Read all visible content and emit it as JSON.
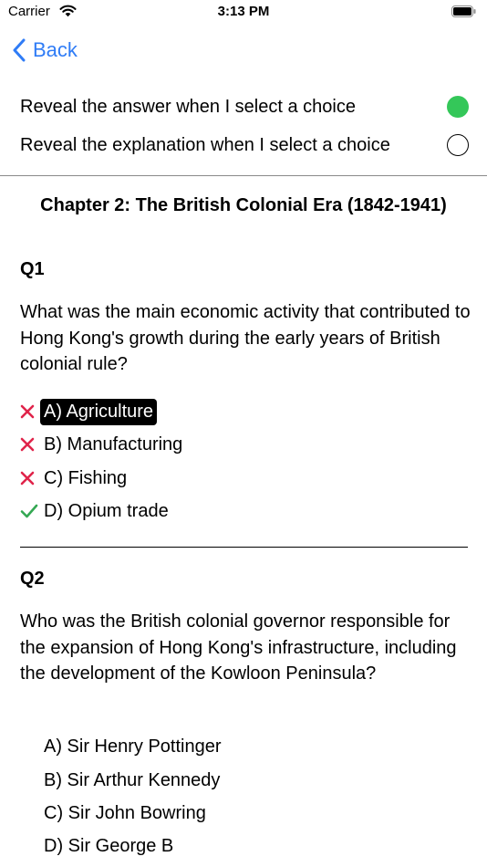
{
  "status_bar": {
    "carrier": "Carrier",
    "time": "3:13 PM"
  },
  "nav": {
    "back_label": "Back",
    "accent_color": "#2f7cf6"
  },
  "settings": {
    "reveal_answer": {
      "label": "Reveal the answer when I select a choice",
      "enabled": true
    },
    "reveal_explanation": {
      "label": "Reveal the explanation when I select a choice",
      "enabled": false
    }
  },
  "chapter": {
    "title": "Chapter 2: The British Colonial Era (1842-1941)"
  },
  "questions": [
    {
      "label": "Q1",
      "text": "What was the main economic activity that contributed to Hong Kong's growth during the early years of British colonial rule?",
      "choices": [
        {
          "text": "A) Agriculture",
          "mark": "x-icon",
          "selected": true
        },
        {
          "text": "B) Manufacturing",
          "mark": "x-icon",
          "selected": false
        },
        {
          "text": "C) Fishing",
          "mark": "x-icon",
          "selected": false
        },
        {
          "text": "D) Opium trade",
          "mark": "checkmark-icon",
          "selected": false
        }
      ]
    },
    {
      "label": "Q2",
      "text": "Who was the British colonial governor responsible for the expansion of Hong Kong's infrastructure, including the development of the Kowloon Peninsula?",
      "choices": [
        {
          "text": "A) Sir Henry Pottinger"
        },
        {
          "text": "B) Sir Arthur Kennedy"
        },
        {
          "text": "C) Sir John Bowring"
        },
        {
          "text": "D) Sir George B"
        }
      ]
    }
  ],
  "colors": {
    "correct": "#34a853",
    "wrong": "#e0244a",
    "toggle_on": "#34c759"
  }
}
